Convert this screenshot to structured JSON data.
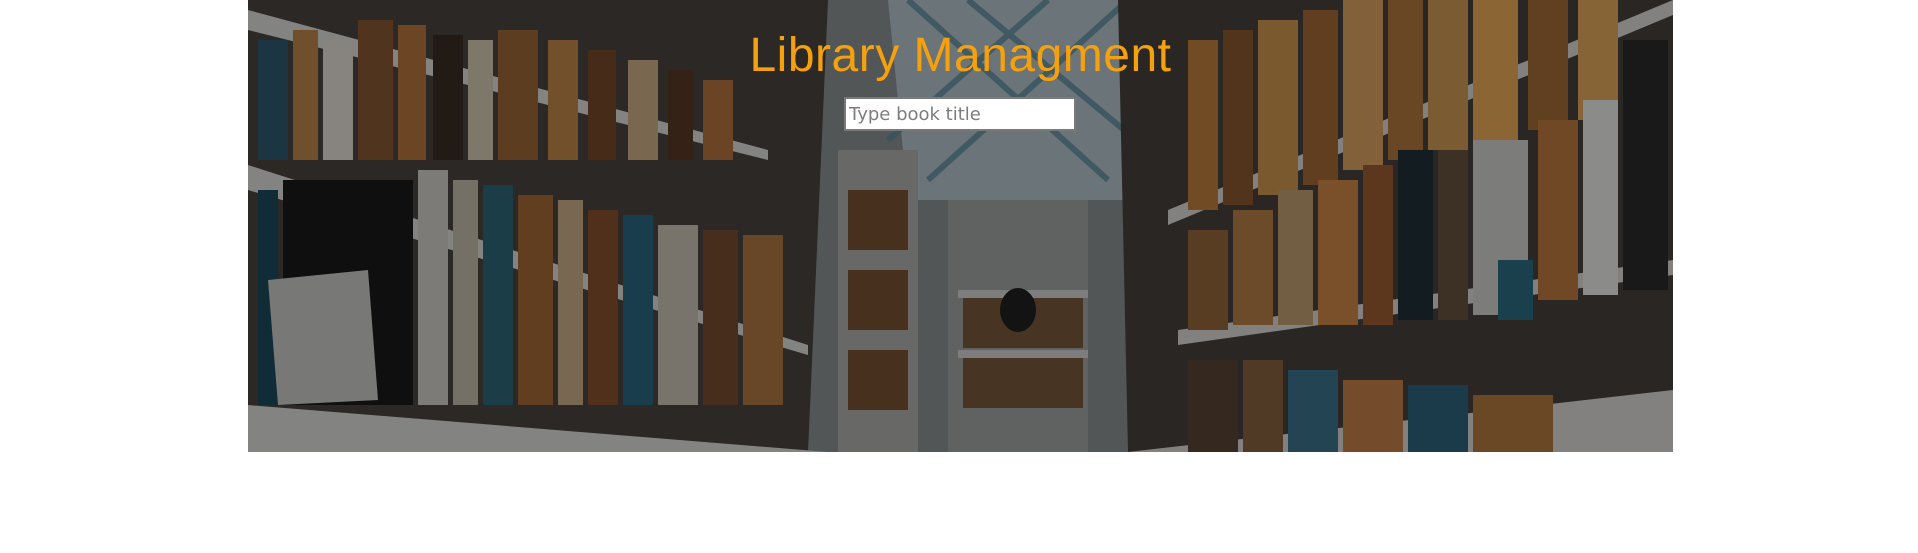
{
  "header": {
    "title": "Library Managment",
    "title_color": "#f5a10e"
  },
  "search": {
    "placeholder": "Type book title",
    "value": ""
  },
  "hero": {
    "image": "library-bookshelves-aisle"
  }
}
